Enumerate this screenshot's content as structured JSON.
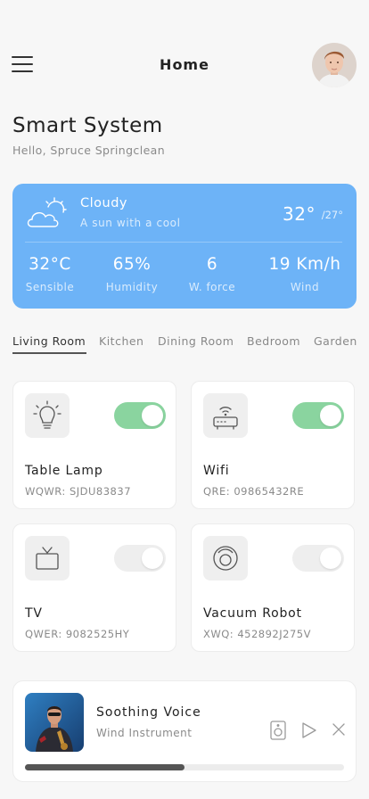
{
  "header": {
    "title": "Home"
  },
  "app": {
    "title": "Smart System",
    "greeting": "Hello, Spruce Springclean"
  },
  "weather": {
    "condition": "Cloudy",
    "description": "A sun with a cool",
    "temp": "32°",
    "low": "/27°",
    "stats": [
      {
        "value": "32°C",
        "label": "Sensible"
      },
      {
        "value": "65%",
        "label": "Humidity"
      },
      {
        "value": "6",
        "label": "W. force"
      },
      {
        "value": "19 Km/h",
        "label": "Wind"
      }
    ]
  },
  "rooms": {
    "active": "Living Room",
    "tabs": [
      "Living Room",
      "Kitchen",
      "Dining Room",
      "Bedroom",
      "Garden"
    ]
  },
  "devices": [
    {
      "name": "Table Lamp",
      "code": "WQWR: SJDU83837",
      "icon": "lightbulb-icon",
      "on": true
    },
    {
      "name": "Wifi",
      "code": "QRE: 09865432RE",
      "icon": "router-icon",
      "on": true
    },
    {
      "name": "TV",
      "code": "QWER: 9082525HY",
      "icon": "tv-icon",
      "on": false
    },
    {
      "name": "Vacuum Robot",
      "code": "XWQ: 452892J275V",
      "icon": "robot-vacuum-icon",
      "on": false
    }
  ],
  "player": {
    "title": "Soothing Voice",
    "subtitle": "Wind Instrument",
    "progress": 0.5
  },
  "colors": {
    "accent_blue": "#6db3f7",
    "toggle_on": "#8ad49f",
    "toggle_off": "#eeeeee"
  }
}
